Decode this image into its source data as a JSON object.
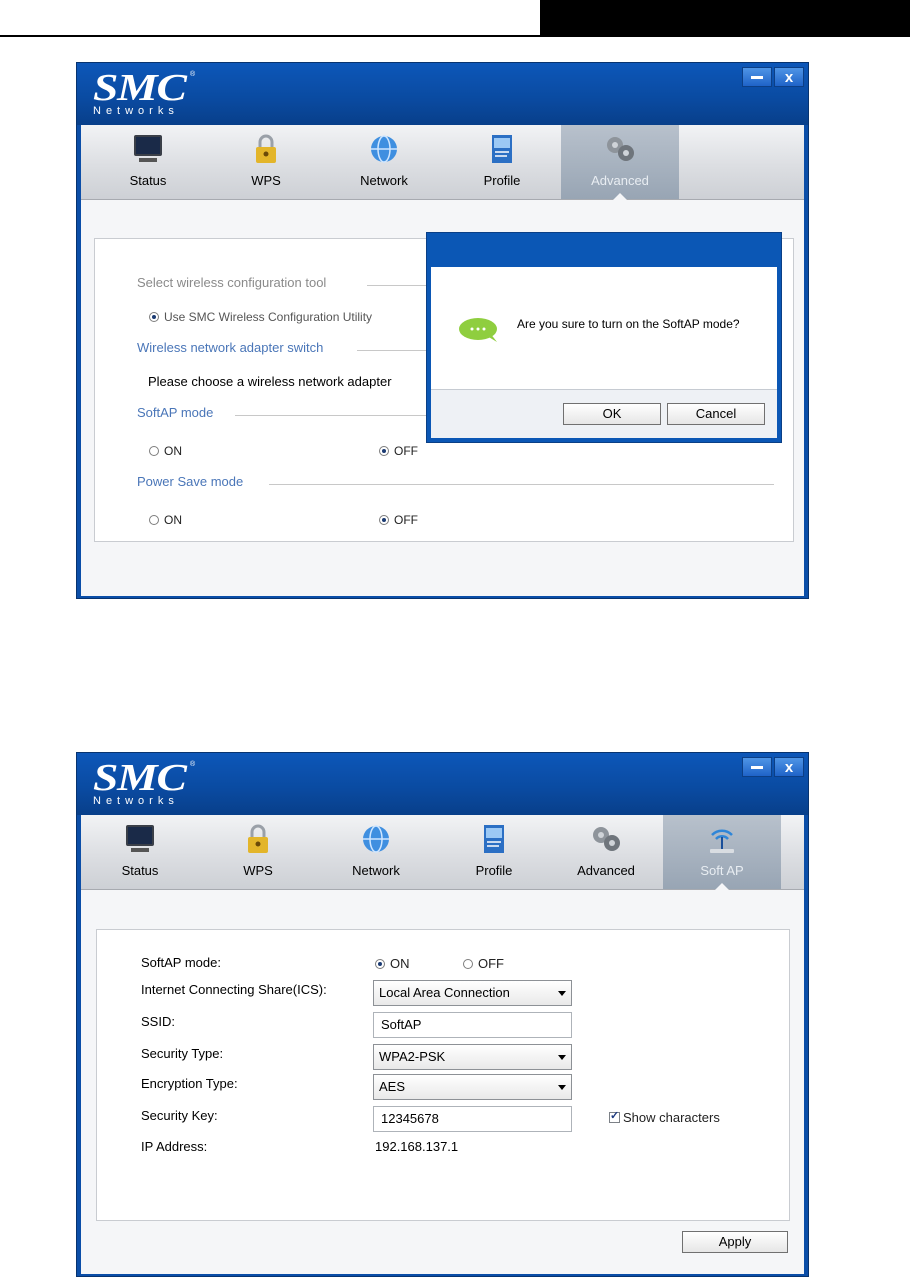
{
  "app": {
    "logo": "SMC",
    "logo_sub": "Networks",
    "logo_reg": "®",
    "minimize_label": "",
    "close_label": "x"
  },
  "window1": {
    "tabs": [
      {
        "label": "Status",
        "icon": "monitor-icon"
      },
      {
        "label": "WPS",
        "icon": "lock-icon"
      },
      {
        "label": "Network",
        "icon": "globe-icon"
      },
      {
        "label": "Profile",
        "icon": "profile-icon"
      },
      {
        "label": "Advanced",
        "icon": "gears-icon"
      }
    ],
    "active_tab": "Advanced",
    "sections": {
      "config_tool": "Select wireless configuration tool",
      "config_tool_option": "Use SMC Wireless Configuration Utility",
      "adapter_switch": "Wireless network adapter switch",
      "adapter_text": "Please choose a wireless network adapter",
      "softap": "SoftAP mode",
      "softap_on": "ON",
      "softap_off": "OFF",
      "powersave": "Power Save mode",
      "powersave_on": "ON",
      "powersave_off": "OFF"
    },
    "dialog": {
      "message": "Are you sure to turn on the SoftAP mode?",
      "ok": "OK",
      "cancel": "Cancel",
      "icon": "chat-bubble-icon"
    }
  },
  "window2": {
    "tabs": [
      {
        "label": "Status",
        "icon": "monitor-icon"
      },
      {
        "label": "WPS",
        "icon": "lock-icon"
      },
      {
        "label": "Network",
        "icon": "globe-icon"
      },
      {
        "label": "Profile",
        "icon": "profile-icon"
      },
      {
        "label": "Advanced",
        "icon": "gears-icon"
      },
      {
        "label": "Soft AP",
        "icon": "softap-icon"
      }
    ],
    "active_tab": "Soft AP",
    "form": {
      "softap_label": "SoftAP mode:",
      "softap_on": "ON",
      "softap_off": "OFF",
      "ics_label": "Internet Connecting Share(ICS):",
      "ics_value": "Local Area Connection",
      "ssid_label": "SSID:",
      "ssid_value": "SoftAP",
      "security_label": "Security Type:",
      "security_value": "WPA2-PSK",
      "encryption_label": "Encryption Type:",
      "encryption_value": "AES",
      "key_label": "Security Key:",
      "key_value": "12345678",
      "show_chars": "Show characters",
      "ip_label": "IP Address:",
      "ip_value": "192.168.137.1",
      "apply": "Apply"
    }
  },
  "colors": {
    "titlebar": "#0b4ea8",
    "section_blue": "#4a76b8",
    "dialog_blue": "#0b57b5"
  }
}
